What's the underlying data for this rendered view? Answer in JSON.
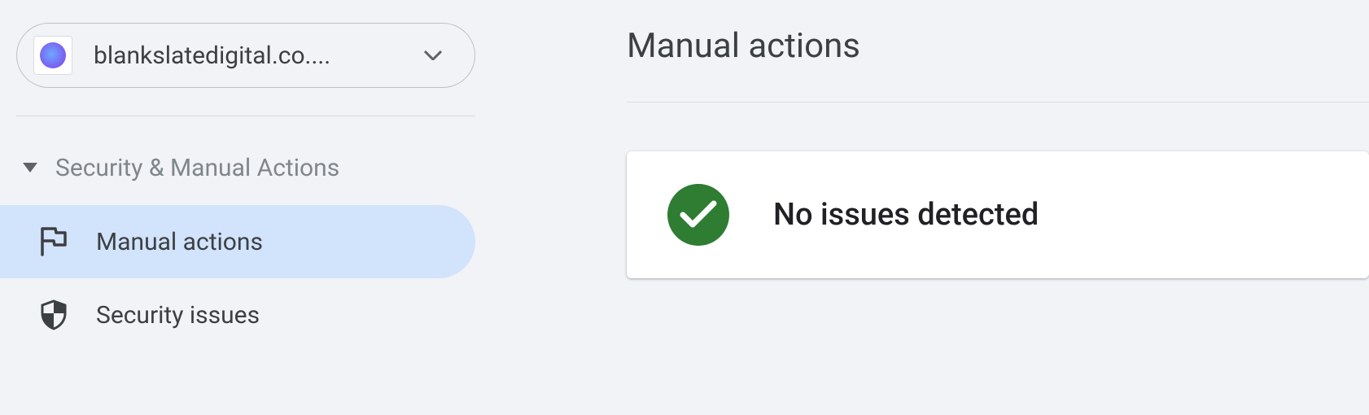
{
  "property": {
    "name": "blankslatedigital.co...."
  },
  "section": {
    "title": "Security & Manual Actions",
    "items": [
      {
        "label": "Manual actions",
        "icon": "flag",
        "active": true
      },
      {
        "label": "Security issues",
        "icon": "shield",
        "active": false
      }
    ]
  },
  "page": {
    "title": "Manual actions"
  },
  "status": {
    "message": "No issues detected",
    "ok": true
  }
}
